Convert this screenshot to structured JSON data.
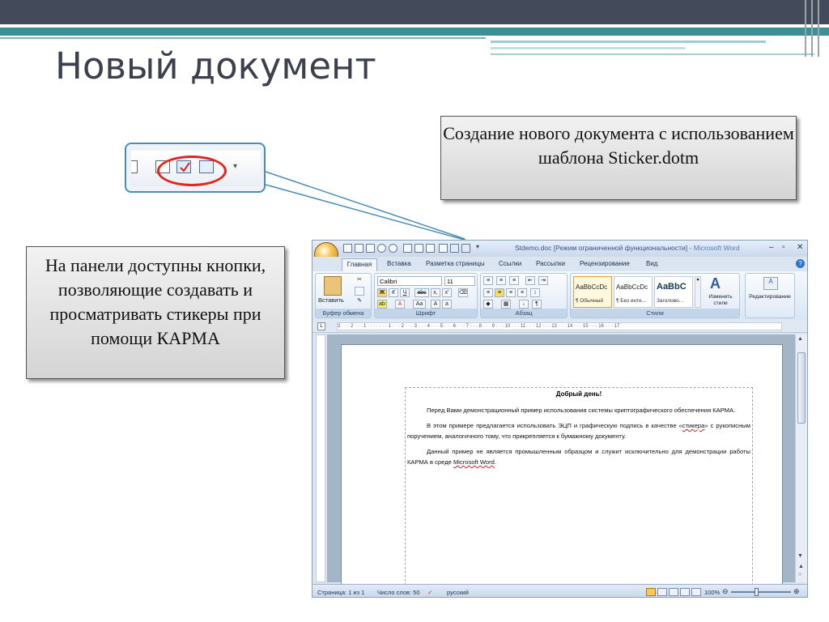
{
  "slide": {
    "title": "Новый документ"
  },
  "callouts": {
    "right": "Создание нового документа с использованием шаблона Sticker.dotm",
    "left": "На панели доступны кнопки, позволяющие создавать и просматривать стикеры при помощи КАРМА"
  },
  "word": {
    "window_title": "Stdemo.doc [Режим ограниченной функциональности]",
    "app_name": "Microsoft Word",
    "tabs": [
      "Главная",
      "Вставка",
      "Разметка страницы",
      "Ссылки",
      "Рассылки",
      "Рецензирование",
      "Вид"
    ],
    "groups": {
      "clipboard": "Буфер обмена",
      "font": "Шрифт",
      "paragraph": "Абзац",
      "styles": "Стили"
    },
    "paste_label": "Вставить",
    "font_name": "Calibri",
    "font_size": "11",
    "styles": [
      {
        "sample": "AaBbCcDc",
        "name": "¶ Обычный"
      },
      {
        "sample": "AaBbCcDc",
        "name": "¶ Без инте..."
      },
      {
        "sample": "AaBbC",
        "name": "Заголово..."
      }
    ],
    "change_styles": "Изменить стили",
    "editing": "Редактирование",
    "ruler_text": "3 · · · 2 · · · 1 · · · · · · · 1 · · · 2 · · · 3 · · · 4 · · · 5 · · · 6 · · · 7 · · · 8 · · · 9 · · · 10 · · · 11 · · · 12 · · · 13 · · · 14 · · · 15 · · · 16 · · · 17",
    "document": {
      "heading": "Добрый день!",
      "p1": "Перед Вами демонстрационный пример использования системы криптографического обеспечения КАРМА.",
      "p2_pre": "В этом примере предлагается использовать ЭЦП и графическую подпись в качестве «",
      "p2_link": "стикера",
      "p2_post": "» с рукописным поручением, аналогичного тому, что прикрепляется к бумажному документу.",
      "p3_pre": "Данный пример не является промышленным образцом и служит исключительно для демонстрации работы КАРМА в среде ",
      "p3_link": "Microsoft Word",
      "p3_post": "."
    },
    "status": {
      "page": "Страница: 1 из 1",
      "words": "Число слов: 50",
      "language": "русский",
      "zoom": "100%"
    }
  },
  "colors": {
    "accent_teal": "#3c8f96",
    "highlight_ellipse": "#e3241c",
    "title_text": "#3b3f4e"
  }
}
